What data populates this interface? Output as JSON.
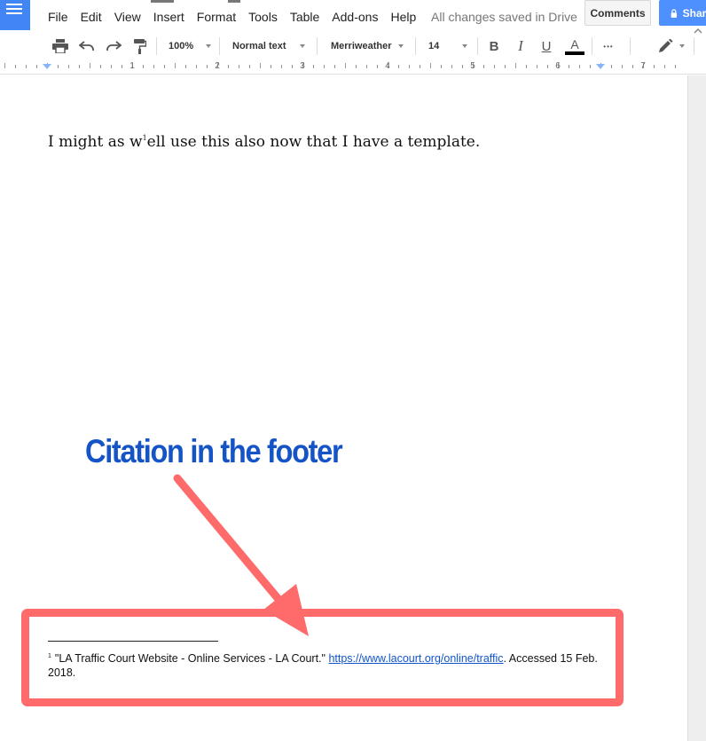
{
  "menu": {
    "items": [
      "File",
      "Edit",
      "View",
      "Insert",
      "Format",
      "Tools",
      "Table",
      "Add-ons",
      "Help"
    ],
    "save_status": "All changes saved in Drive"
  },
  "header": {
    "comments_label": "Comments",
    "share_label": "Share"
  },
  "toolbar": {
    "zoom": "100%",
    "style": "Normal text",
    "font": "Merriweather",
    "font_size": "14",
    "bold_label": "B",
    "italic_label": "I",
    "underline_label": "U",
    "text_color_label": "A",
    "more_label": "•••",
    "text_color": "#000000"
  },
  "ruler": {
    "numbers": [
      "1",
      "2",
      "3",
      "4",
      "5",
      "6",
      "7"
    ]
  },
  "document": {
    "body_before": "I might as w",
    "footnote_marker": "1",
    "body_after": "ell use this also now that I have a template.",
    "footnote": {
      "marker": "1",
      "text_before": "\"LA Traffic Court Website - Online Services - LA Court.\" ",
      "link": "https://www.lacourt.org/online/traffic",
      "text_after": ". Accessed 15 Feb. 2018."
    }
  },
  "annotation": {
    "label": "Citation in the footer",
    "label_color": "#1554c7",
    "arrow_color": "#ff6b6b",
    "box_color": "#ff6b6b"
  }
}
